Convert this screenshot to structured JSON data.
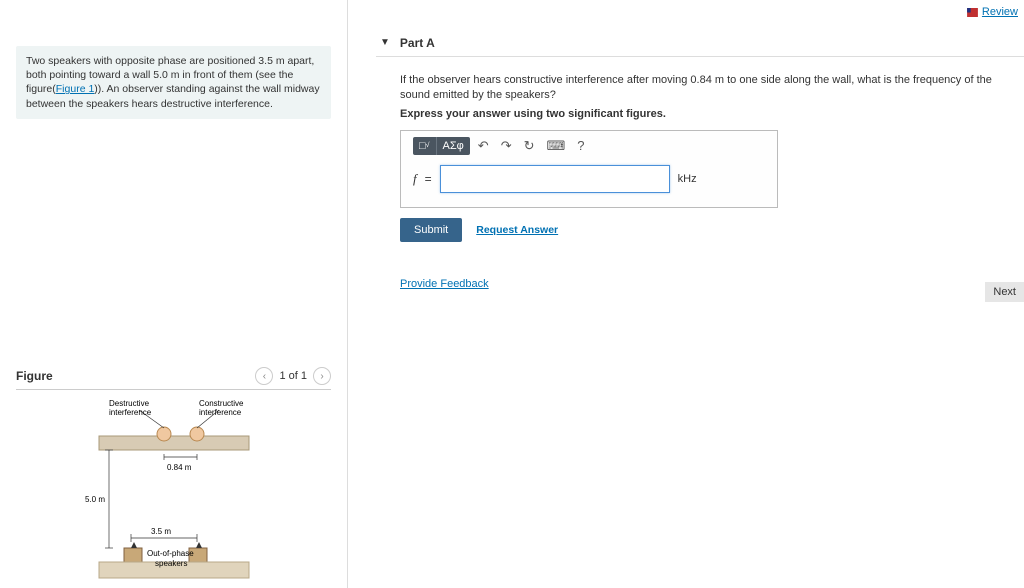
{
  "header": {
    "review_label": "Review"
  },
  "problem": {
    "text_parts": [
      "Two speakers with opposite phase are positioned 3.5 m apart, both pointing toward a wall 5.0 m in front of them (see the figure(",
      ")). An observer standing against the wall midway between the speakers hears destructive interference."
    ],
    "figure_link_text": "Figure 1"
  },
  "figure": {
    "title": "Figure",
    "counter": "1 of 1",
    "labels": {
      "destructive": "Destructive\ninterference",
      "constructive": "Constructive\ninterference",
      "d084": "0.84 m",
      "d50": "5.0 m",
      "d35": "3.5 m",
      "speakers": "Out-of-phase\nspeakers"
    }
  },
  "part": {
    "label": "Part A",
    "question": "If the observer hears constructive interference after moving 0.84 m to one side along the wall, what is the frequency of the sound emitted by the speakers?",
    "instruction": "Express your answer using two significant figures.",
    "variable": "f",
    "equals": "=",
    "unit": "kHz",
    "input_value": "",
    "submit_label": "Submit",
    "request_label": "Request Answer",
    "toolbar": {
      "sqrt": "√x",
      "sigma": "ΑΣφ",
      "undo": "↶",
      "redo": "↷",
      "reset": "↻",
      "keyboard": "⌨",
      "help": "?"
    }
  },
  "footer": {
    "feedback": "Provide Feedback",
    "next": "Next"
  }
}
